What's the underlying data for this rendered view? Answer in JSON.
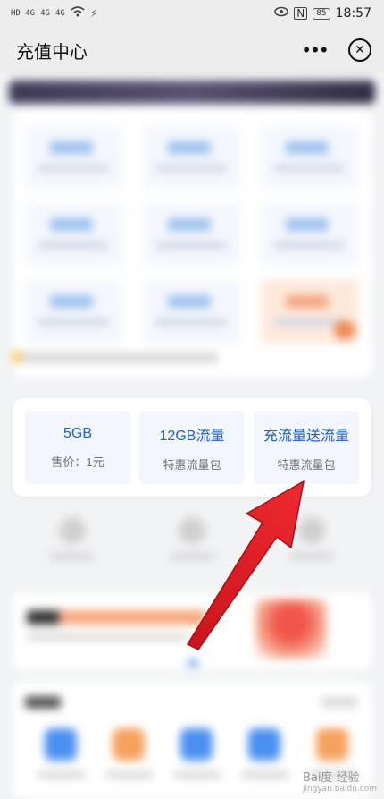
{
  "status_bar": {
    "signal_1": "HD 4G",
    "signal_2": "4G",
    "signal_3": "4G",
    "battery": "85",
    "time": "18:57"
  },
  "header": {
    "title": "充值中心",
    "more_label": "•••",
    "close_label": "✕"
  },
  "packages": [
    {
      "title": "5GB",
      "subtitle": "售价：1元"
    },
    {
      "title": "12GB流量",
      "subtitle": "特惠流量包"
    },
    {
      "title": "充流量送流量",
      "subtitle": "特惠流量包"
    }
  ],
  "annotation": {
    "color": "#e8242a"
  },
  "watermark": {
    "text": "Bai度 经验",
    "sub": "jingyan.baidu.com"
  },
  "colors": {
    "accent": "#1f5fc6",
    "package_bg": "#f3f7fd"
  }
}
